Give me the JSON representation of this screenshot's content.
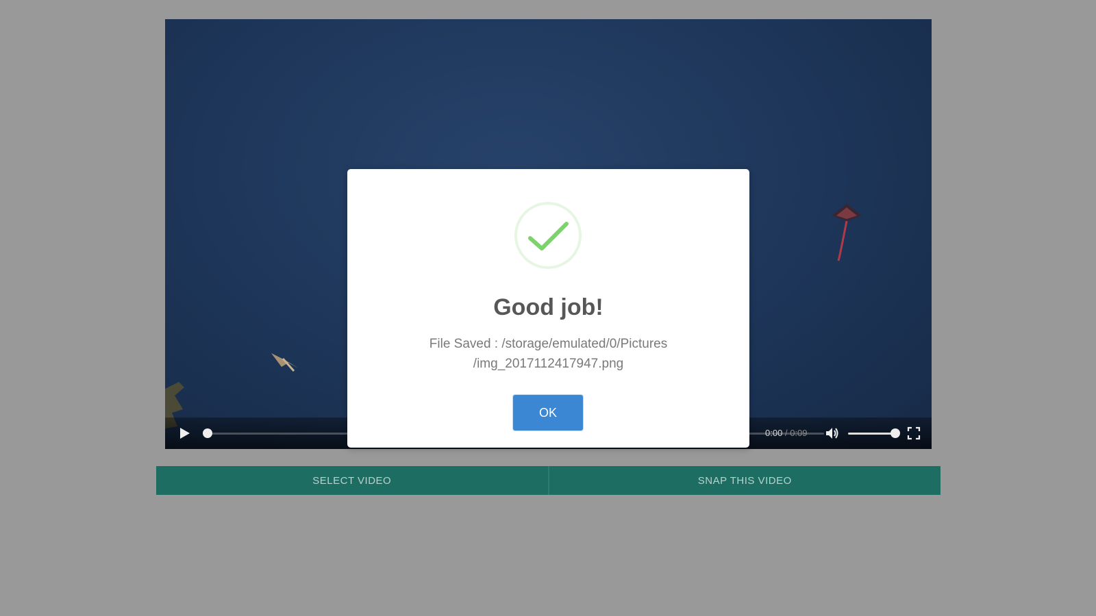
{
  "video": {
    "current_time": "0:00",
    "separator": "/",
    "duration": "0:09",
    "progress": 0,
    "volume": 1.0
  },
  "actions": {
    "select_label": "SELECT VIDEO",
    "snap_label": "SNAP THIS VIDEO"
  },
  "dialog": {
    "title": "Good job!",
    "message_line1": "File Saved : /storage/emulated/0/Pictures",
    "message_line2": "/img_2017112417947.png",
    "ok_label": "OK"
  },
  "colors": {
    "page_background": "#999999",
    "video_sky": "#1d3558",
    "action_bar": "#1e6d62",
    "success_green": "#7dd36b",
    "ok_button": "#3c87d4"
  }
}
